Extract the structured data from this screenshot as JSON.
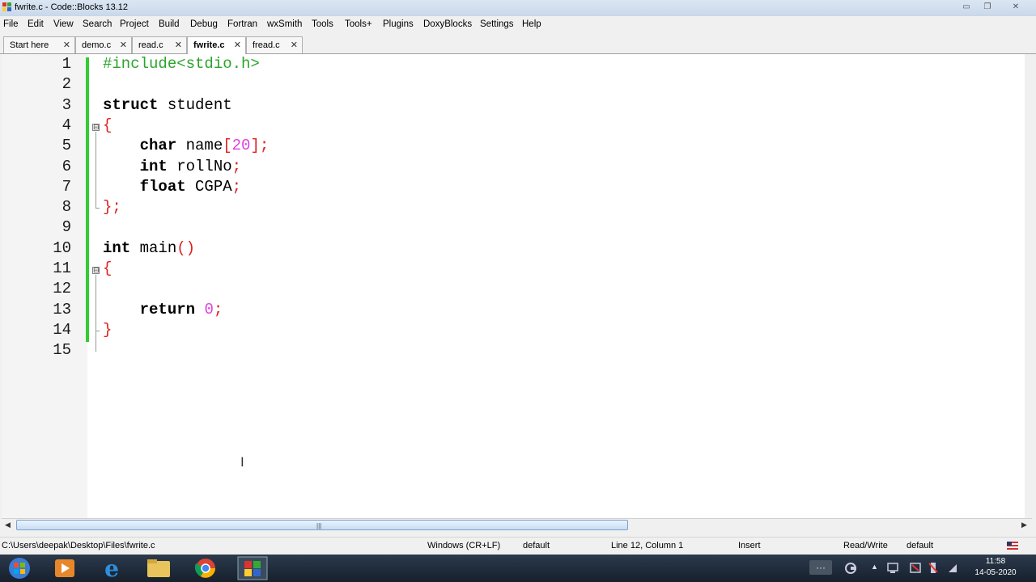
{
  "window": {
    "title": "fwrite.c - Code::Blocks 13.12",
    "min_glyph": "▭",
    "max_glyph": "❐",
    "close_glyph": "✕"
  },
  "menu": [
    "File",
    "Edit",
    "View",
    "Search",
    "Project",
    "Build",
    "Debug",
    "Fortran",
    "wxSmith",
    "Tools",
    "Tools+",
    "Plugins",
    "DoxyBlocks",
    "Settings",
    "Help"
  ],
  "tabs": [
    {
      "label": "Start here",
      "active": false
    },
    {
      "label": "demo.c",
      "active": false
    },
    {
      "label": "read.c",
      "active": false
    },
    {
      "label": "fwrite.c",
      "active": true
    },
    {
      "label": "fread.c",
      "active": false
    }
  ],
  "tab_close_glyph": "✕",
  "editor": {
    "line_numbers": [
      "1",
      "2",
      "3",
      "4",
      "5",
      "6",
      "7",
      "8",
      "9",
      "10",
      "11",
      "12",
      "13",
      "14",
      "15"
    ],
    "fold_markers": {
      "minus": "⊟"
    },
    "lines": [
      [
        {
          "t": "#include<stdio.h>",
          "c": "pp"
        }
      ],
      [],
      [
        {
          "t": "struct",
          "c": "kw"
        },
        {
          "t": " student",
          "c": ""
        }
      ],
      [
        {
          "t": "{",
          "c": "op"
        }
      ],
      [
        {
          "t": "    ",
          "c": ""
        },
        {
          "t": "char",
          "c": "kw"
        },
        {
          "t": " name",
          "c": ""
        },
        {
          "t": "[",
          "c": "op"
        },
        {
          "t": "20",
          "c": "num"
        },
        {
          "t": "];",
          "c": "op"
        }
      ],
      [
        {
          "t": "    ",
          "c": ""
        },
        {
          "t": "int",
          "c": "kw"
        },
        {
          "t": " rollNo",
          "c": ""
        },
        {
          "t": ";",
          "c": "op"
        }
      ],
      [
        {
          "t": "    ",
          "c": ""
        },
        {
          "t": "float",
          "c": "kw"
        },
        {
          "t": " CGPA",
          "c": ""
        },
        {
          "t": ";",
          "c": "op"
        }
      ],
      [
        {
          "t": "};",
          "c": "op"
        }
      ],
      [],
      [
        {
          "t": "int",
          "c": "kw"
        },
        {
          "t": " main",
          "c": ""
        },
        {
          "t": "()",
          "c": "op"
        }
      ],
      [
        {
          "t": "{",
          "c": "op"
        }
      ],
      [],
      [
        {
          "t": "    ",
          "c": ""
        },
        {
          "t": "return",
          "c": "kw"
        },
        {
          "t": " ",
          "c": ""
        },
        {
          "t": "0",
          "c": "num"
        },
        {
          "t": ";",
          "c": "op"
        }
      ],
      [
        {
          "t": "}",
          "c": "op"
        }
      ],
      []
    ],
    "cursor_glyph": "I"
  },
  "scrollbar": {
    "left_arrow": "◀",
    "right_arrow": "▶",
    "grip": "|||"
  },
  "status": {
    "path": "C:\\Users\\deepak\\Desktop\\Files\\fwrite.c",
    "eol": "Windows (CR+LF)",
    "encoding": "default",
    "position": "Line 12, Column 1",
    "mode": "Insert",
    "access": "Read/Write",
    "lang": "default"
  },
  "taskbar": {
    "time": "11:58",
    "date": "14-05-2020",
    "tray_up": "▲",
    "tray_more": "···"
  },
  "colors": {
    "change_bar": "#33cc33",
    "preprocessor": "#2aa52a",
    "operator": "#e02020",
    "number": "#e040e0"
  }
}
